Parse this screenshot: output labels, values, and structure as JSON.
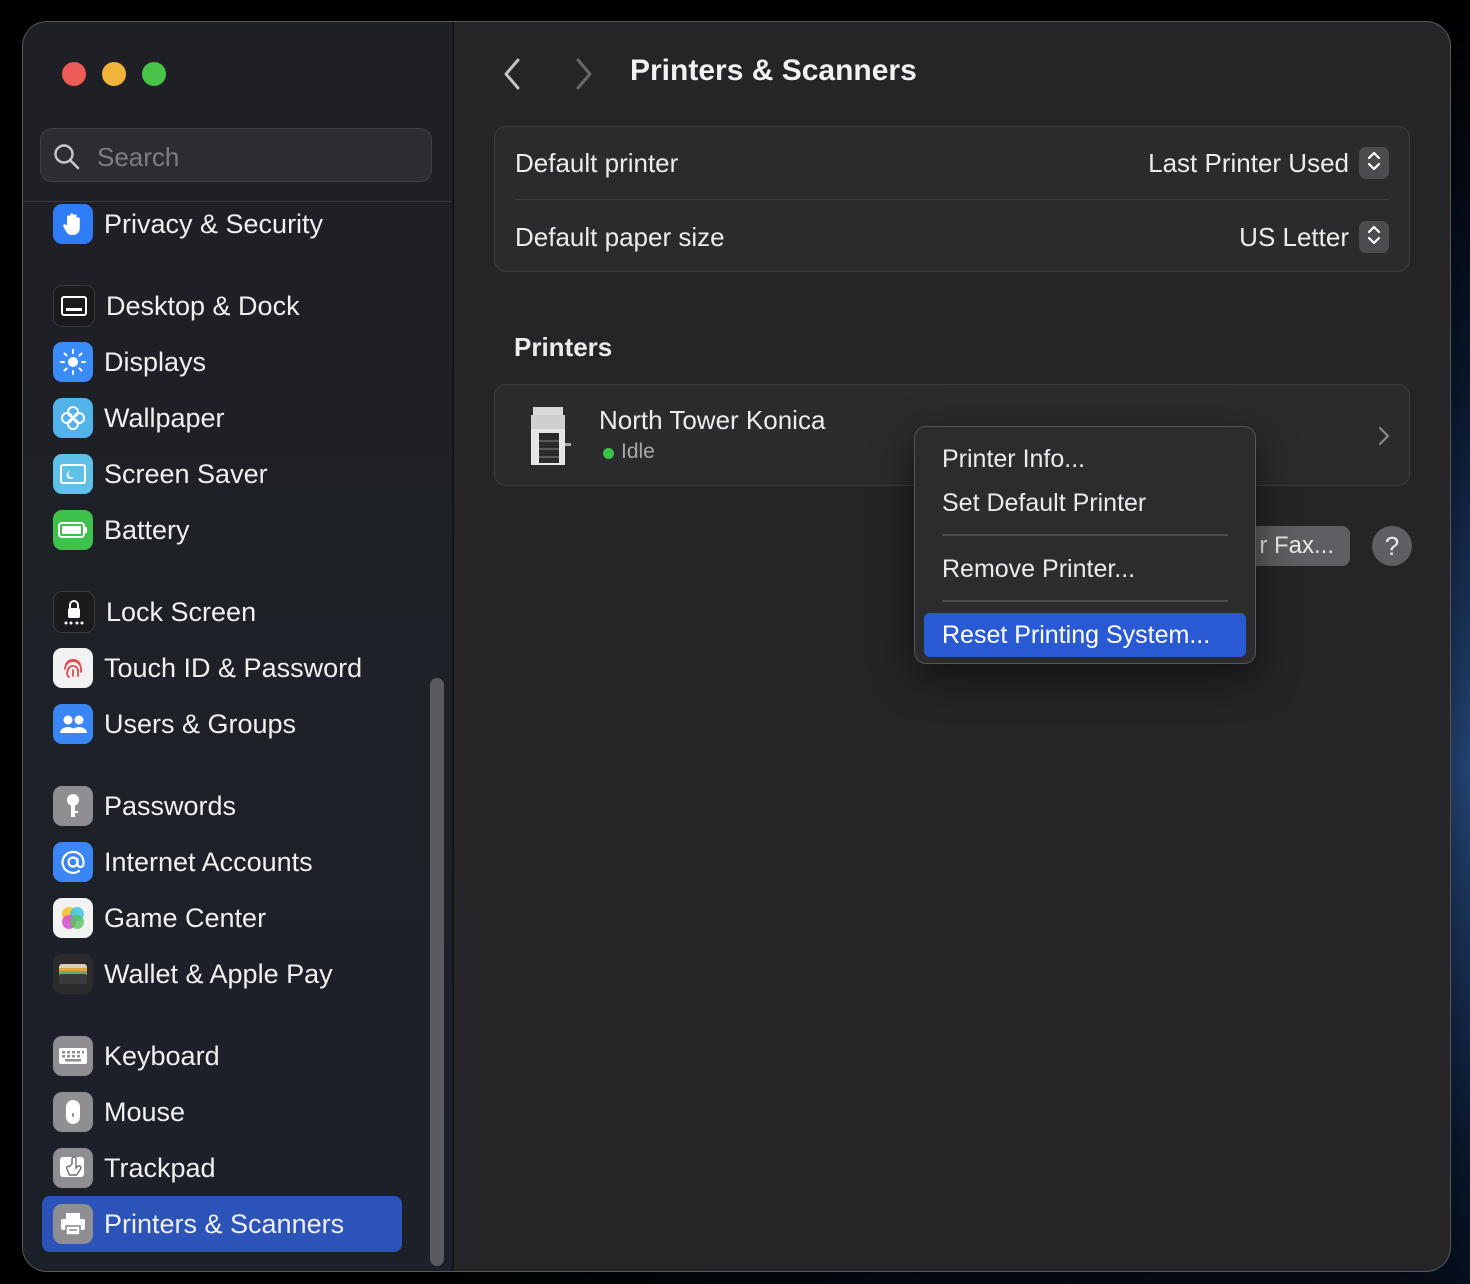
{
  "window": {
    "title": "Printers & Scanners"
  },
  "search": {
    "placeholder": "Search"
  },
  "sidebar": {
    "items": [
      {
        "label": "Privacy & Security",
        "icon": "hand-icon",
        "color": "#2f7df6"
      },
      {
        "label": "Desktop & Dock",
        "icon": "dock-icon",
        "color": "#1b1b1d"
      },
      {
        "label": "Displays",
        "icon": "sun-icon",
        "color": "#3b8cf7"
      },
      {
        "label": "Wallpaper",
        "icon": "flower-icon",
        "color": "#52b2ea"
      },
      {
        "label": "Screen Saver",
        "icon": "screensaver-icon",
        "color": "#5fc0e8"
      },
      {
        "label": "Battery",
        "icon": "battery-icon",
        "color": "#3fc24b"
      },
      {
        "label": "Lock Screen",
        "icon": "lock-icon",
        "color": "#1b1b1d"
      },
      {
        "label": "Touch ID & Password",
        "icon": "fingerprint-icon",
        "color": "#f2f2f2"
      },
      {
        "label": "Users & Groups",
        "icon": "users-icon",
        "color": "#3b86f5"
      },
      {
        "label": "Passwords",
        "icon": "key-icon",
        "color": "#8e8e93"
      },
      {
        "label": "Internet Accounts",
        "icon": "at-icon",
        "color": "#3b86f5"
      },
      {
        "label": "Game Center",
        "icon": "game-center-icon",
        "color": "#f2f2f2"
      },
      {
        "label": "Wallet & Apple Pay",
        "icon": "wallet-icon",
        "color": "#2b2b2d"
      },
      {
        "label": "Keyboard",
        "icon": "keyboard-icon",
        "color": "#8e8e93"
      },
      {
        "label": "Mouse",
        "icon": "mouse-icon",
        "color": "#8e8e93"
      },
      {
        "label": "Trackpad",
        "icon": "trackpad-icon",
        "color": "#8e8e93"
      },
      {
        "label": "Printers & Scanners",
        "icon": "printer-icon",
        "color": "#8e8e93",
        "selected": true
      }
    ]
  },
  "settings": {
    "default_printer_label": "Default printer",
    "default_printer_value": "Last Printer Used",
    "paper_size_label": "Default paper size",
    "paper_size_value": "US Letter"
  },
  "printers": {
    "section_title": "Printers",
    "list": [
      {
        "name": "North Tower Konica",
        "status": "Idle",
        "status_color": "#3cc14b"
      }
    ]
  },
  "buttons": {
    "fax_label": "r Fax...",
    "help_label": "?"
  },
  "context_menu": {
    "items": [
      {
        "label": "Printer Info..."
      },
      {
        "label": "Set Default Printer"
      },
      {
        "label": "Remove Printer..."
      },
      {
        "label": "Reset Printing System...",
        "highlighted": true
      }
    ]
  },
  "colors": {
    "accent": "#2c54b8",
    "menu_highlight": "#2a5ad3",
    "window_bg": "#252528"
  }
}
